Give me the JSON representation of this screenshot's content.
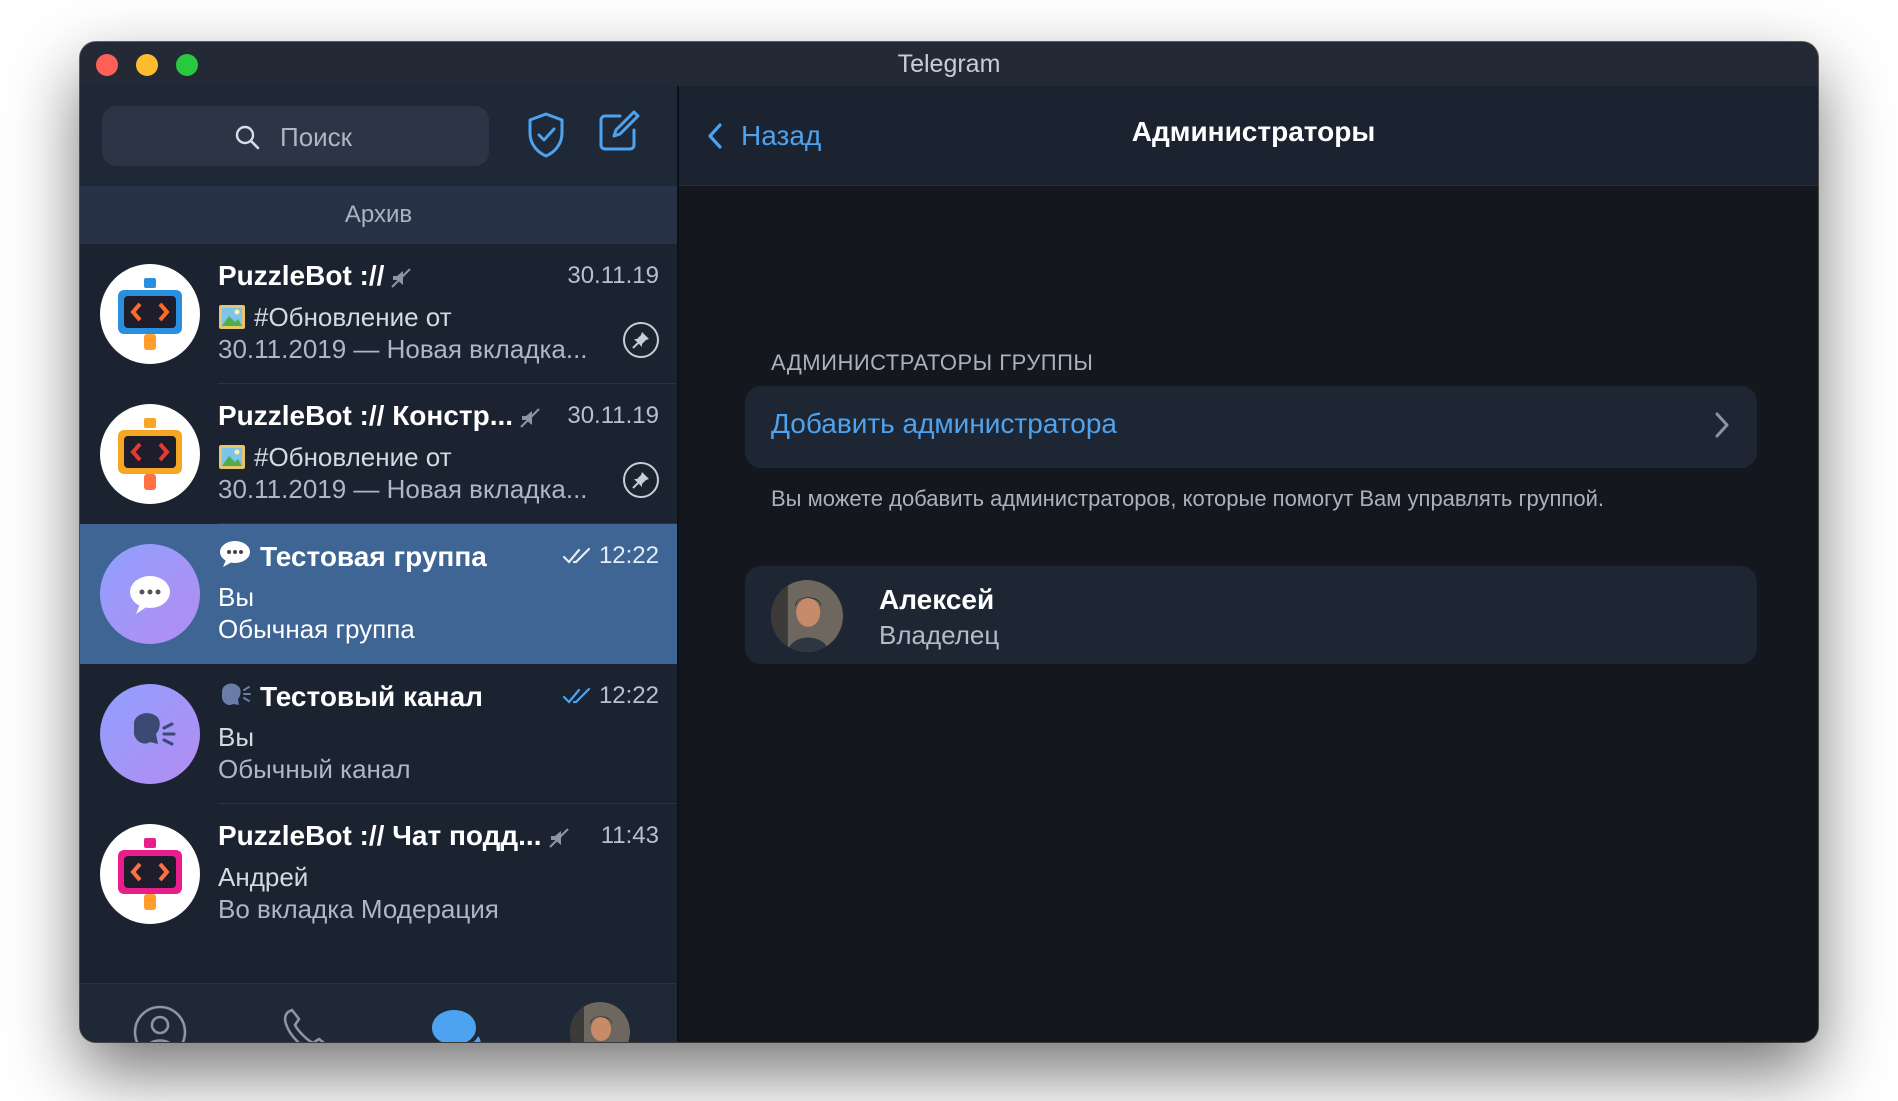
{
  "window": {
    "title": "Telegram"
  },
  "sidebar": {
    "search_placeholder": "Поиск",
    "archive_label": "Архив",
    "chats": [
      {
        "name": "PuzzleBot ://",
        "time": "30.11.19",
        "line1": "#Обновление от",
        "line2": "30.11.2019 — Новая вкладка...",
        "muted": true,
        "pinned": true
      },
      {
        "name": "PuzzleBot :// Констр...",
        "time": "30.11.19",
        "line1": "#Обновление от",
        "line2": "30.11.2019 — Новая вкладка...",
        "muted": true,
        "pinned": true
      },
      {
        "name": "Тестовая группа",
        "time": "12:22",
        "line1": "Вы",
        "line2": "Обычная группа",
        "selected": true
      },
      {
        "name": "Тестовый канал",
        "time": "12:22",
        "line1": "Вы",
        "line2": "Обычный канал"
      },
      {
        "name": "PuzzleBot :// Чат подд...",
        "time": "11:43",
        "line1": "Андрей",
        "line2": "Во вкладка Модерация",
        "muted": true
      }
    ],
    "tabs": [
      "contacts-icon",
      "calls-icon",
      "chats-icon",
      "settings-avatar"
    ]
  },
  "header": {
    "back_label": "Назад",
    "title": "Администраторы"
  },
  "admins": {
    "section_label": "АДМИНИСТРАТОРЫ ГРУППЫ",
    "add_label": "Добавить администратора",
    "hint": "Вы можете добавить администраторов, которые помогут Вам управлять группой.",
    "owner": {
      "name": "Алексей",
      "role": "Владелец"
    }
  },
  "colors": {
    "accent": "#4ea3f0",
    "selected": "#3e6594",
    "sidebar": "#1b2230",
    "main_bg": "#14171d"
  }
}
